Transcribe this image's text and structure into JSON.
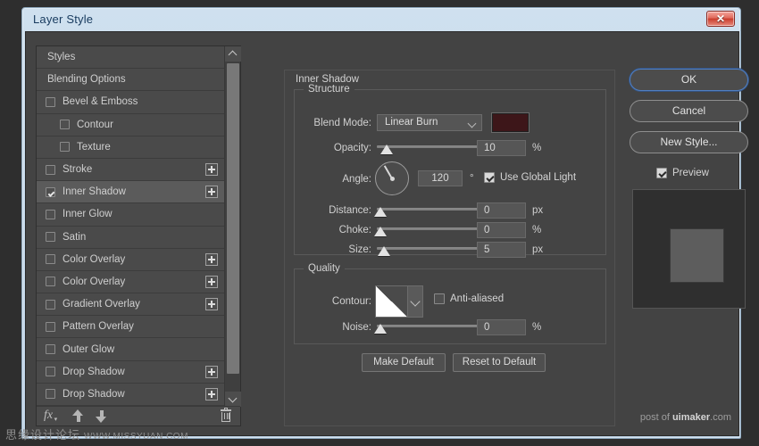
{
  "window": {
    "title": "Layer Style",
    "close_label": "✕"
  },
  "styles_panel": {
    "items": [
      {
        "label": "Styles",
        "checkbox": false,
        "checked": false,
        "indent": false,
        "plus": false,
        "selected": false
      },
      {
        "label": "Blending Options",
        "checkbox": false,
        "checked": false,
        "indent": false,
        "plus": false,
        "selected": false
      },
      {
        "label": "Bevel & Emboss",
        "checkbox": true,
        "checked": false,
        "indent": false,
        "plus": false,
        "selected": false
      },
      {
        "label": "Contour",
        "checkbox": true,
        "checked": false,
        "indent": true,
        "plus": false,
        "selected": false
      },
      {
        "label": "Texture",
        "checkbox": true,
        "checked": false,
        "indent": true,
        "plus": false,
        "selected": false
      },
      {
        "label": "Stroke",
        "checkbox": true,
        "checked": false,
        "indent": false,
        "plus": true,
        "selected": false
      },
      {
        "label": "Inner Shadow",
        "checkbox": true,
        "checked": true,
        "indent": false,
        "plus": true,
        "selected": true
      },
      {
        "label": "Inner Glow",
        "checkbox": true,
        "checked": false,
        "indent": false,
        "plus": false,
        "selected": false
      },
      {
        "label": "Satin",
        "checkbox": true,
        "checked": false,
        "indent": false,
        "plus": false,
        "selected": false
      },
      {
        "label": "Color Overlay",
        "checkbox": true,
        "checked": false,
        "indent": false,
        "plus": true,
        "selected": false
      },
      {
        "label": "Color Overlay",
        "checkbox": true,
        "checked": false,
        "indent": false,
        "plus": true,
        "selected": false
      },
      {
        "label": "Gradient Overlay",
        "checkbox": true,
        "checked": false,
        "indent": false,
        "plus": true,
        "selected": false
      },
      {
        "label": "Pattern Overlay",
        "checkbox": true,
        "checked": false,
        "indent": false,
        "plus": false,
        "selected": false
      },
      {
        "label": "Outer Glow",
        "checkbox": true,
        "checked": false,
        "indent": false,
        "plus": false,
        "selected": false
      },
      {
        "label": "Drop Shadow",
        "checkbox": true,
        "checked": false,
        "indent": false,
        "plus": true,
        "selected": false
      },
      {
        "label": "Drop Shadow",
        "checkbox": true,
        "checked": false,
        "indent": false,
        "plus": true,
        "selected": false
      }
    ],
    "toolbar": {
      "fx_label": "fx",
      "fx_caret": "▾"
    }
  },
  "settings": {
    "effect_title": "Inner Shadow",
    "structure": {
      "title": "Structure",
      "blend_mode_label": "Blend Mode:",
      "blend_mode_value": "Linear Burn",
      "color_swatch": "#3d1619",
      "opacity_label": "Opacity:",
      "opacity_value": "10",
      "opacity_unit": "%",
      "angle_label": "Angle:",
      "angle_value": "120",
      "angle_unit": "°",
      "use_global_light_label": "Use Global Light",
      "use_global_light_checked": true,
      "distance_label": "Distance:",
      "distance_value": "0",
      "distance_unit": "px",
      "choke_label": "Choke:",
      "choke_value": "0",
      "choke_unit": "%",
      "size_label": "Size:",
      "size_value": "5",
      "size_unit": "px"
    },
    "quality": {
      "title": "Quality",
      "contour_label": "Contour:",
      "anti_aliased_label": "Anti-aliased",
      "anti_aliased_checked": false,
      "noise_label": "Noise:",
      "noise_value": "0",
      "noise_unit": "%"
    },
    "make_default_label": "Make Default",
    "reset_default_label": "Reset to Default"
  },
  "actions": {
    "ok_label": "OK",
    "cancel_label": "Cancel",
    "new_style_label": "New Style...",
    "preview_label": "Preview",
    "preview_checked": true
  },
  "watermarks": {
    "left_cn": "思缘设计论坛",
    "left_url": "WWW.MISSYUAN.COM",
    "right_prefix": "post of ",
    "right_brand": "uimaker",
    "right_suffix": ".com"
  }
}
